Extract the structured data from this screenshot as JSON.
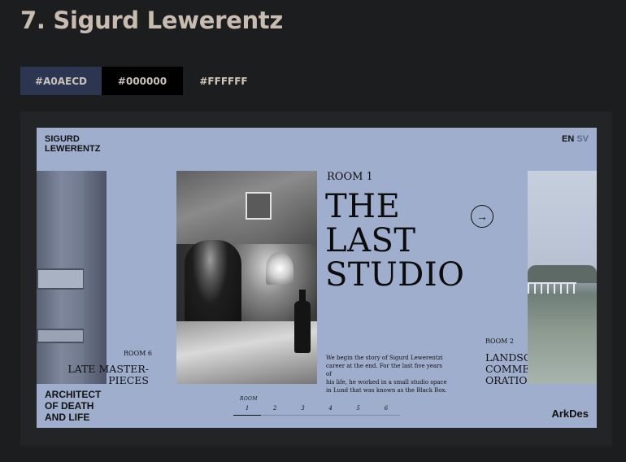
{
  "heading": "7. Sigurd Lewerentz",
  "palette": [
    {
      "hex": "#A0AECD",
      "bg": "#2c3650",
      "fg": "#c9c2ba"
    },
    {
      "hex": "#000000",
      "bg": "#000000",
      "fg": "#c9c2ba"
    },
    {
      "hex": "#FFFFFF",
      "bg": "#1c1d1f",
      "fg": "#d2c6b9"
    }
  ],
  "slide": {
    "background": "#a0aecd",
    "brand": [
      "SIGURD",
      "LEWERENTZ"
    ],
    "lang": {
      "active": "EN",
      "inactive": "SV"
    },
    "room1": {
      "label": "ROOM 1",
      "title": [
        "THE",
        "LAST",
        "STUDIO"
      ],
      "arrow": "→",
      "description": [
        "We begin the story of Sigurd Lewerentzi",
        "career at the end. For the last five years of",
        "his life, he worked in a small studio space",
        "in Lund that was known as the Black Box."
      ]
    },
    "room6": {
      "label": "ROOM 6",
      "title": [
        "LATE MASTER-",
        "PIECES"
      ]
    },
    "architect": [
      "ARCHITECT",
      "OF DEATH",
      "AND LIFE"
    ],
    "room2": {
      "label": "ROOM 2",
      "title": [
        "LANDSCAPES OF",
        "COMMEM-",
        "ORATION"
      ]
    },
    "pager": {
      "label": "ROOM",
      "items": [
        "1",
        "2",
        "3",
        "4",
        "5",
        "6"
      ],
      "active": "1"
    },
    "logo": "ArkDes"
  }
}
